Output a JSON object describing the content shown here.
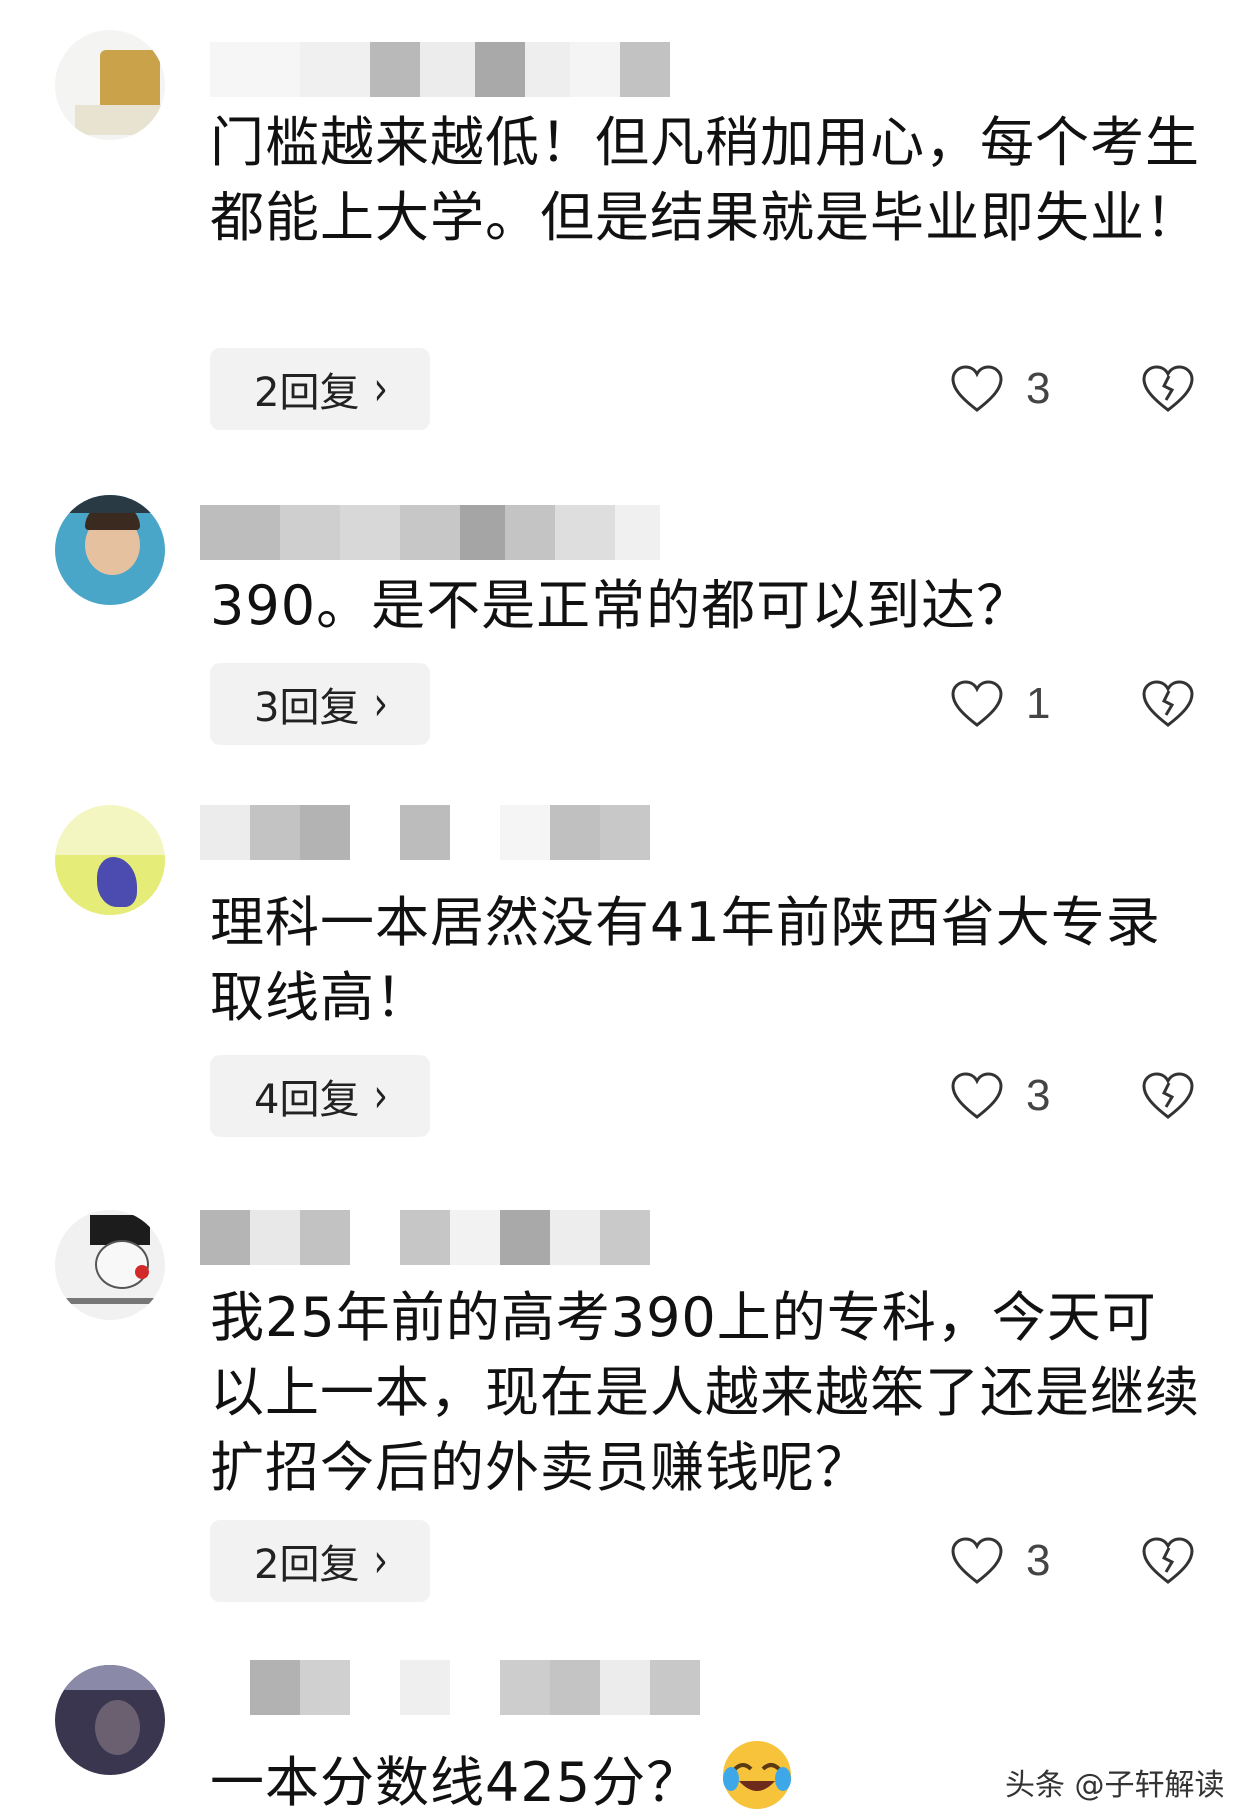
{
  "comments": [
    {
      "text": "门槛越来越低！但凡稍加用心，每个考生都能上大学。但是结果就是毕业即失业！",
      "reply_label": "2回复",
      "likes": "3"
    },
    {
      "text": "390。是不是正常的都可以到达？",
      "reply_label": "3回复",
      "likes": "1"
    },
    {
      "text": "理科一本居然没有41年前陕西省大专录取线高！",
      "reply_label": "4回复",
      "likes": "3"
    },
    {
      "text": "我25年前的高考390上的专科，今天可以上一本，现在是人越来越笨了还是继续扩招今后的外卖员赚钱呢？",
      "reply_label": "2回复",
      "likes": "3"
    },
    {
      "text": "一本分数线425分？"
    }
  ],
  "icons": {
    "like": "heart-outline-icon",
    "dislike": "broken-heart-icon",
    "chevron": "chevron-right-icon",
    "emoji": "laughing-crying-emoji"
  },
  "watermark": "头条 @子轩解读"
}
